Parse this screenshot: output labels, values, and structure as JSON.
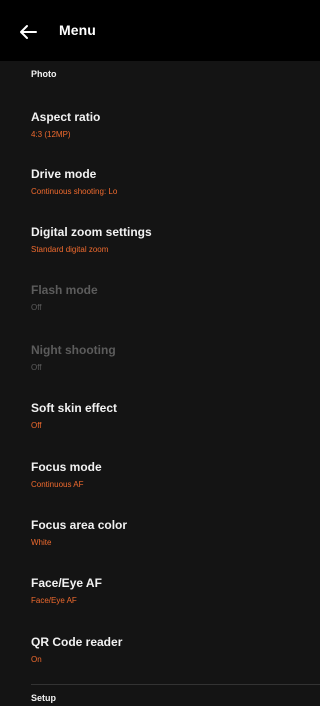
{
  "header": {
    "title": "Menu",
    "back_icon": "arrow-left-icon"
  },
  "sections": {
    "photo": "Photo",
    "setup": "Setup"
  },
  "settings": [
    {
      "label": "Aspect ratio",
      "value": "4:3 (12MP)",
      "enabled": true
    },
    {
      "label": "Drive mode",
      "value": "Continuous shooting: Lo",
      "enabled": true
    },
    {
      "label": "Digital zoom settings",
      "value": "Standard digital zoom",
      "enabled": true
    },
    {
      "label": "Flash mode",
      "value": "Off",
      "enabled": false
    },
    {
      "label": "Night shooting",
      "value": "Off",
      "enabled": false
    },
    {
      "label": "Soft skin effect",
      "value": "Off",
      "enabled": true
    },
    {
      "label": "Focus mode",
      "value": "Continuous AF",
      "enabled": true
    },
    {
      "label": "Focus area color",
      "value": "White",
      "enabled": true
    },
    {
      "label": "Face/Eye AF",
      "value": "Face/Eye AF",
      "enabled": true
    },
    {
      "label": "QR Code reader",
      "value": "On",
      "enabled": true
    }
  ],
  "colors": {
    "background": "#141414",
    "header": "#000000",
    "accent": "#ef6a2e",
    "disabled": "#5c5c5c"
  }
}
